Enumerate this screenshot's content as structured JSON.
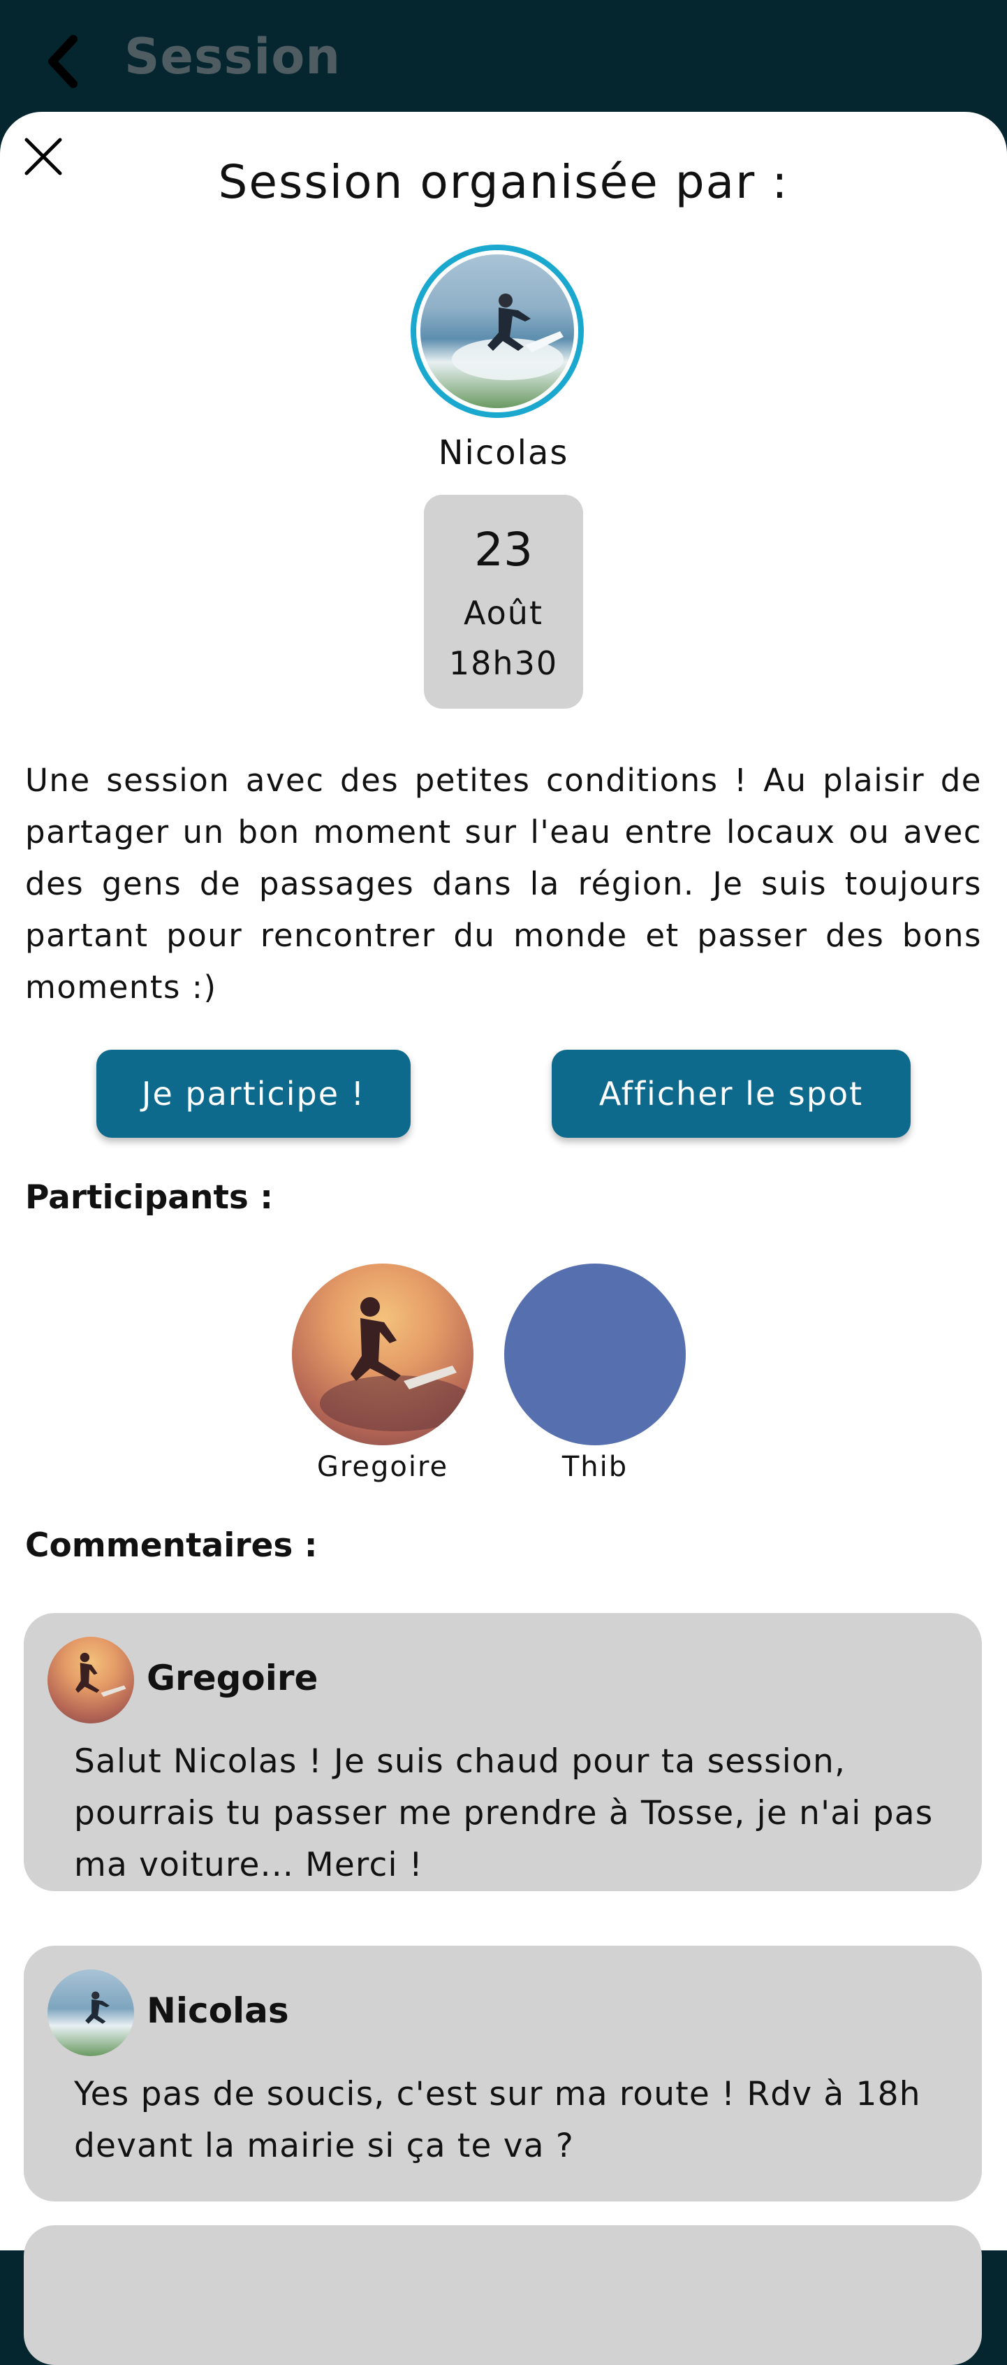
{
  "header": {
    "back_icon": "chevron-left-icon",
    "title": "Session"
  },
  "modal": {
    "close_icon": "close-icon",
    "title": "Session organisée par :",
    "organizer": {
      "name": "Nicolas"
    },
    "date": {
      "day": "23",
      "month": "Août",
      "time": "18h30"
    },
    "description": "Une session avec des petites conditions ! Au plaisir de partager un bon moment sur l'eau entre locaux ou avec des gens de passages dans la région. Je suis toujours partant pour rencontrer du monde et passer des bons moments :)",
    "buttons": {
      "participate": "Je participe !",
      "show_spot": "Afficher le spot"
    },
    "participants_label": "Participants :",
    "participants": [
      {
        "name": "Gregoire"
      },
      {
        "name": "Thib"
      }
    ],
    "comments_label": "Commentaires :",
    "comments": [
      {
        "author": "Gregoire",
        "text": "Salut Nicolas ! Je suis chaud pour ta session, pourrais tu passer me prendre à Tosse, je n'ai pas ma voiture... Merci !"
      },
      {
        "author": "Nicolas",
        "text": "Yes pas de soucis, c'est sur ma route ! Rdv à 18h devant la mairie si ça te va ?"
      }
    ]
  },
  "colors": {
    "header_bg": "#05262f",
    "accent": "#0e6a8d",
    "avatar_ring": "#1aa8cf",
    "card_bg": "#d3d2d3"
  }
}
